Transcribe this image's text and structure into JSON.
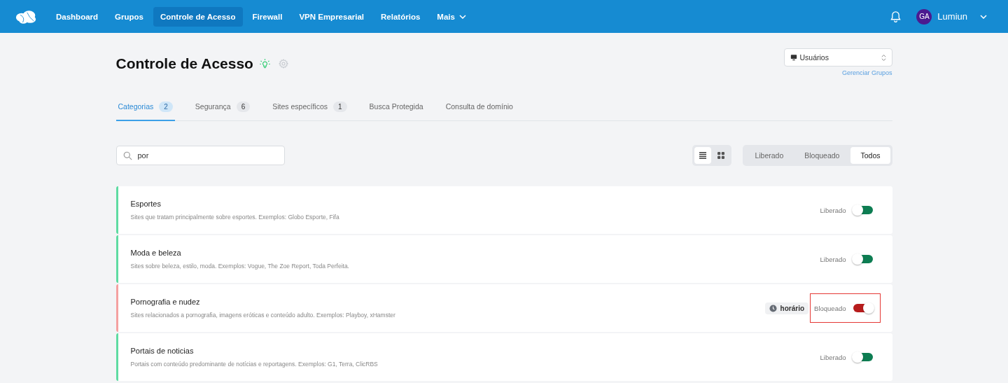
{
  "nav": {
    "items": [
      {
        "label": "Dashboard",
        "selected": false
      },
      {
        "label": "Grupos",
        "selected": false
      },
      {
        "label": "Controle de Acesso",
        "selected": true
      },
      {
        "label": "Firewall",
        "selected": false
      },
      {
        "label": "VPN Empresarial",
        "selected": false
      },
      {
        "label": "Relatórios",
        "selected": false
      },
      {
        "label": "Mais",
        "selected": false,
        "kind": "dropdown"
      }
    ],
    "user": {
      "initials": "GA",
      "name": "Lumiun"
    }
  },
  "header": {
    "title": "Controle de Acesso",
    "group_select": {
      "value": "Usuários"
    },
    "manage_link": "Gerenciar Grupos"
  },
  "tabs": [
    {
      "label": "Categorias",
      "count": "2",
      "selected": true
    },
    {
      "label": "Segurança",
      "count": "6",
      "selected": false
    },
    {
      "label": "Sites específicos",
      "count": "1",
      "selected": false
    },
    {
      "label": "Busca Protegida",
      "selected": false
    },
    {
      "label": "Consulta de domínio",
      "selected": false
    }
  ],
  "search": {
    "value": "por"
  },
  "view_modes": [
    {
      "kind": "list",
      "selected": true
    },
    {
      "kind": "grid",
      "selected": false
    }
  ],
  "filters": [
    {
      "label": "Liberado",
      "selected": false
    },
    {
      "label": "Bloqueado",
      "selected": false
    },
    {
      "label": "Todos",
      "selected": true
    }
  ],
  "categories": [
    {
      "name": "Esportes",
      "description": "Sites que tratam principalmente sobre esportes. Exemplos: Globo Esporte, Fifa",
      "status": "Liberado",
      "blocked": false,
      "highlighted": false
    },
    {
      "name": "Moda e beleza",
      "description": "Sites sobre beleza, estilo, moda. Exemplos: Vogue, The Zoe Report, Toda Perfeita.",
      "status": "Liberado",
      "blocked": false,
      "highlighted": false
    },
    {
      "name": "Pornografia e nudez",
      "description": "Sites relacionados a pornografia, imagens eróticas e conteúdo adulto. Exemplos: Playboy, xHamster",
      "status": "Bloqueado",
      "blocked": true,
      "schedule": "horário",
      "highlighted": true
    },
    {
      "name": "Portais de noticias",
      "description": "Portais com conteúdo predominante de notícias e reportagens. Exemplos: G1, Terra, ClicRBS",
      "status": "Liberado",
      "blocked": false,
      "highlighted": false
    }
  ]
}
